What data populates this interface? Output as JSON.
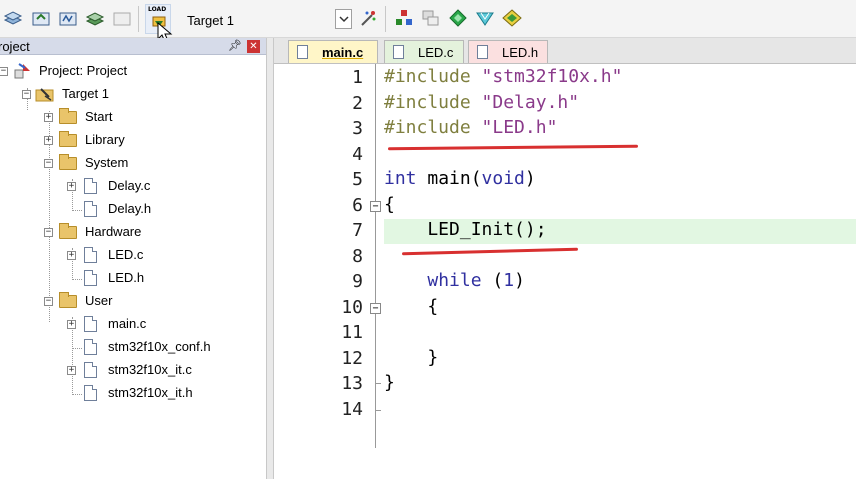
{
  "toolbar": {
    "load_label": "LOAD",
    "target_value": "Target 1"
  },
  "project": {
    "title": "roject",
    "tree": {
      "root": "Project: Project",
      "target": "Target 1",
      "groups": [
        "Start",
        "Library",
        "System",
        "Hardware",
        "User"
      ],
      "system_files": [
        "Delay.c",
        "Delay.h"
      ],
      "hardware_files": [
        "LED.c",
        "LED.h"
      ],
      "user_files": [
        "main.c",
        "stm32f10x_conf.h",
        "stm32f10x_it.c",
        "stm32f10x_it.h"
      ]
    }
  },
  "editor": {
    "tabs": [
      "main.c",
      "LED.c",
      "LED.h"
    ],
    "active_tab": "main.c",
    "line_numbers": [
      "1",
      "2",
      "3",
      "4",
      "5",
      "6",
      "7",
      "8",
      "9",
      "10",
      "11",
      "12",
      "13",
      "14"
    ],
    "code": {
      "l1a": "#include ",
      "l1b": "\"stm32f10x.h\"",
      "l2a": "#include ",
      "l2b": "\"Delay.h\"",
      "l3a": "#include ",
      "l3b": "\"LED.h\"",
      "l5a": "int",
      "l5b": " main(",
      "l5c": "void",
      "l5d": ")",
      "l6": "{",
      "l7": "    LED_Init();",
      "l9a": "    ",
      "l9b": "while",
      "l9c": " (",
      "l9d": "1",
      "l9e": ")",
      "l10": "    {",
      "l12": "    }",
      "l13": "}"
    }
  },
  "colors": {
    "preprocessor": "#7f7f3f",
    "string": "#8a3a8a",
    "keyword": "#3030a0",
    "current_line": "#e2f7e2",
    "annotation": "#d83030"
  }
}
